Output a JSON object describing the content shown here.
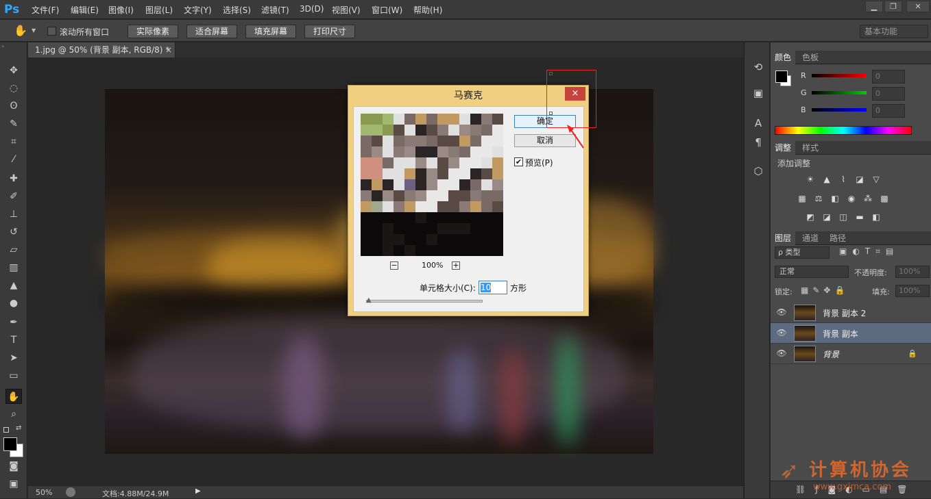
{
  "app": {
    "logo": "Ps"
  },
  "menu": [
    "文件(F)",
    "编辑(E)",
    "图像(I)",
    "图层(L)",
    "文字(Y)",
    "选择(S)",
    "滤镜(T)",
    "3D(D)",
    "视图(V)",
    "窗口(W)",
    "帮助(H)"
  ],
  "options": {
    "scroll_all": "滚动所有窗口",
    "actual_pixels": "实际像素",
    "fit_screen": "适合屏幕",
    "fill_screen": "填充屏幕",
    "print_size": "打印尺寸",
    "workspace": "基本功能"
  },
  "document": {
    "tab_title": "1.jpg @ 50% (背景 副本, RGB/8) *",
    "close": "×"
  },
  "status": {
    "zoom": "50%",
    "doc_info": "文档:4.88M/24.9M"
  },
  "dialog": {
    "title": "马赛克",
    "close": "×",
    "ok": "确定",
    "cancel": "取消",
    "preview_label": "预览(P)",
    "zoom_label": "100%",
    "zoom_out": "−",
    "zoom_in": "+",
    "cell_size_label": "单元格大小(C):",
    "cell_size_value": "10",
    "unit": "方形"
  },
  "color_panel": {
    "tabs": [
      "颜色",
      "色板"
    ],
    "r_label": "R",
    "g_label": "G",
    "b_label": "B",
    "r": "0",
    "g": "0",
    "b": "0"
  },
  "adjust_panel": {
    "tabs": [
      "调整",
      "样式"
    ],
    "title": "添加调整"
  },
  "layers_panel": {
    "tabs": [
      "图层",
      "通道",
      "路径"
    ],
    "kind": "ρ 类型",
    "blend": "正常",
    "opacity_label": "不透明度:",
    "opacity": "100%",
    "lock_label": "锁定:",
    "fill_label": "填充:",
    "fill": "100%",
    "layers": [
      {
        "name": "背景 副本 2"
      },
      {
        "name": "背景 副本"
      },
      {
        "name": "背景"
      }
    ]
  },
  "watermark": {
    "text": "计算机协会",
    "url": "www.gxjmca.com"
  },
  "colors": {
    "accent": "#31a8ff",
    "close_red": "#c7443c",
    "annotation": "#e22222"
  }
}
